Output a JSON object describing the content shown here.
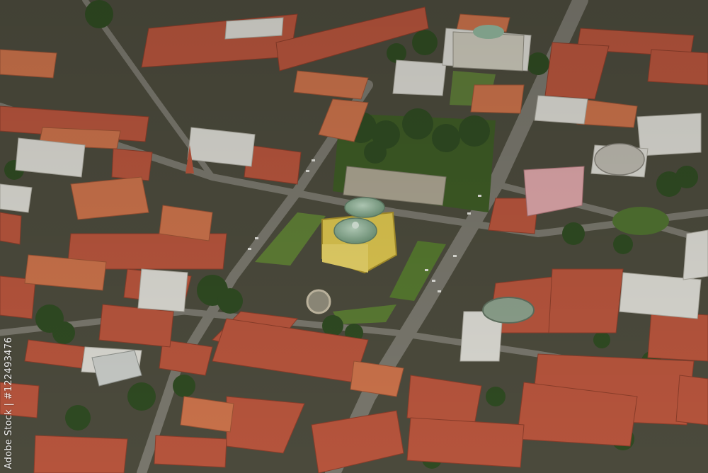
{
  "photo": {
    "subject": "aerial photograph of city centre",
    "stock_watermark": "Adobe Stock | #122493476"
  },
  "colors": {
    "roof_red": "#b5543c",
    "roof_orange": "#c8714a",
    "theatre_yellow": "#d9c24e",
    "dome_green": "#8fb39a",
    "park_green": "#5d7a38",
    "tree_dark": "#2f4a22",
    "street_gray": "#6d6b63",
    "pink_building": "#d9a3a6",
    "white_roof": "#d7d6cf"
  }
}
